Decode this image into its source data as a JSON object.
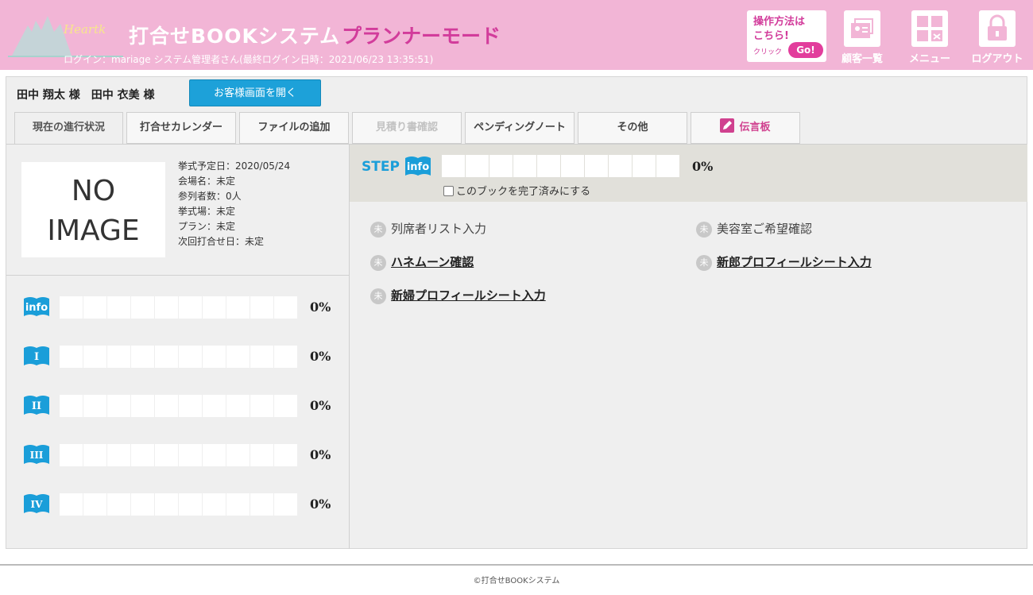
{
  "header": {
    "title": "打合せBOOKシステム",
    "mode": "プランナーモード",
    "login_text": "ログイン：mariage システム管理者さん(最終ログイン日時：2021/06/23 13:35:51)",
    "help": {
      "line1": "操作方法は",
      "line2": "こちら!",
      "click": "クリック",
      "go": "Go!"
    },
    "nav": [
      {
        "label": "顧客一覧",
        "icon": "customer-list-icon"
      },
      {
        "label": "メニュー",
        "icon": "menu-grid-icon"
      },
      {
        "label": "ログアウト",
        "icon": "lock-icon"
      }
    ],
    "accent": "#f2b5d6"
  },
  "customer": {
    "names": "田中 翔太 様　田中 衣美 様",
    "open_button": "お客様画面を開く"
  },
  "tabs": [
    {
      "label": "現在の進行状況",
      "state": "active"
    },
    {
      "label": "打合せカレンダー",
      "state": "normal"
    },
    {
      "label": "ファイルの追加",
      "state": "normal"
    },
    {
      "label": "見積り書確認",
      "state": "disabled"
    },
    {
      "label": "ペンディングノート",
      "state": "normal"
    },
    {
      "label": "その他",
      "state": "normal"
    },
    {
      "label": "伝言板",
      "state": "board"
    }
  ],
  "profile": {
    "no_image_1": "NO",
    "no_image_2": "IMAGE",
    "details": [
      "挙式予定日：2020/05/24",
      "会場名：未定",
      "参列者数：0人",
      "挙式場：未定",
      "プラン：未定",
      "次回打合せ日：未定"
    ]
  },
  "progress": [
    {
      "icon_label": "info",
      "percent": "0%"
    },
    {
      "icon_label": "I",
      "percent": "0%"
    },
    {
      "icon_label": "II",
      "percent": "0%"
    },
    {
      "icon_label": "III",
      "percent": "0%"
    },
    {
      "icon_label": "IV",
      "percent": "0%"
    }
  ],
  "step": {
    "label": "STEP",
    "icon_label": "info",
    "percent": "0%",
    "complete_checkbox": "このブックを完了済みにする",
    "checked": false
  },
  "tasks": [
    {
      "badge": "未",
      "label": "列席者リスト入力",
      "link": false
    },
    {
      "badge": "未",
      "label": "美容室ご希望確認",
      "link": false
    },
    {
      "badge": "未",
      "label": "ハネムーン確認",
      "link": true
    },
    {
      "badge": "未",
      "label": "新郎プロフィールシート入力",
      "link": true
    },
    {
      "badge": "未",
      "label": "新婦プロフィールシート入力",
      "link": true
    }
  ],
  "footer": "©打合せBOOKシステム",
  "colors": {
    "blue": "#1da1d9",
    "pink": "#d23c9b",
    "board": "#d0418f"
  }
}
